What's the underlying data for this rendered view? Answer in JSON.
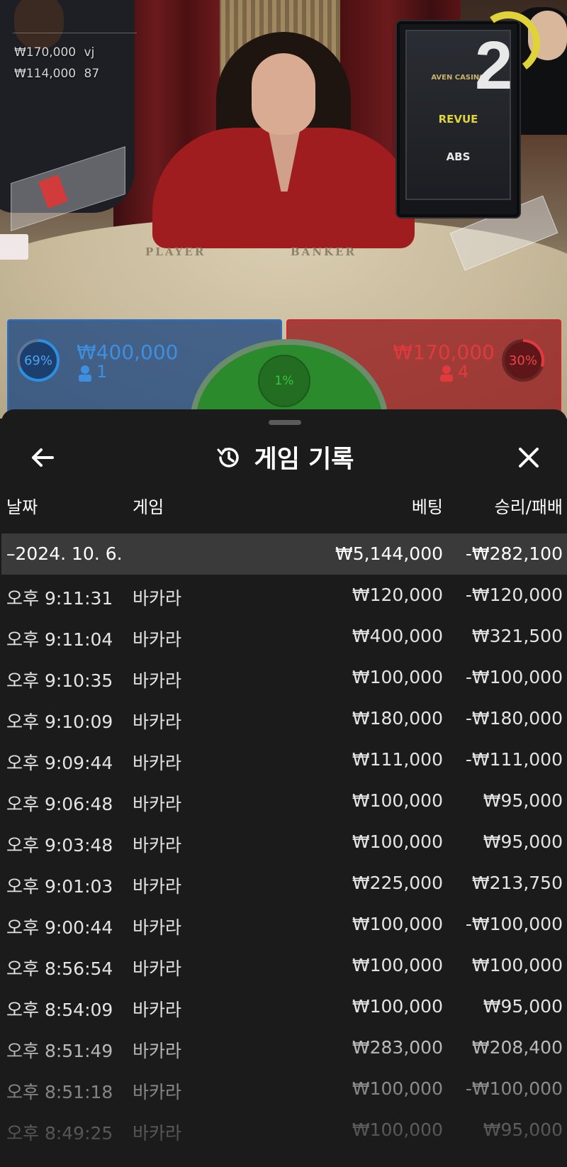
{
  "overlay": {
    "lines": [
      {
        "amount": "₩170,000",
        "user": "vj"
      },
      {
        "amount": "₩114,000",
        "user": "87"
      }
    ]
  },
  "stream": {
    "round_number": "2",
    "table_labels": {
      "player": "PLAYER",
      "banker": "BANKER"
    },
    "monitor_logos": [
      "AVEN CASINO",
      "REVUE",
      "ABS"
    ]
  },
  "bets": {
    "player": {
      "percent": "69%",
      "amount": "₩400,000",
      "players": "1",
      "color": "#2d6fc7"
    },
    "banker": {
      "percent": "30%",
      "amount": "₩170,000",
      "players": "4",
      "color": "#c62a2d"
    },
    "tie": {
      "percent": "1%",
      "color": "#2b8a2b"
    }
  },
  "history": {
    "title": "게임 기록",
    "icons": {
      "back": "back-arrow-icon",
      "history": "history-icon",
      "close": "close-icon"
    },
    "columns": {
      "date": "날짜",
      "game": "게임",
      "bet": "베팅",
      "result": "승리/패배"
    },
    "date_group": {
      "date": "–2024. 10. 6.",
      "bet_total": "₩5,144,000",
      "result_total": "-₩282,100"
    },
    "rows": [
      {
        "time": "오후 9:11:31",
        "game": "바카라",
        "bet": "₩120,000",
        "result": "-₩120,000"
      },
      {
        "time": "오후 9:11:04",
        "game": "바카라",
        "bet": "₩400,000",
        "result": "₩321,500"
      },
      {
        "time": "오후 9:10:35",
        "game": "바카라",
        "bet": "₩100,000",
        "result": "-₩100,000"
      },
      {
        "time": "오후 9:10:09",
        "game": "바카라",
        "bet": "₩180,000",
        "result": "-₩180,000"
      },
      {
        "time": "오후 9:09:44",
        "game": "바카라",
        "bet": "₩111,000",
        "result": "-₩111,000"
      },
      {
        "time": "오후 9:06:48",
        "game": "바카라",
        "bet": "₩100,000",
        "result": "₩95,000"
      },
      {
        "time": "오후 9:03:48",
        "game": "바카라",
        "bet": "₩100,000",
        "result": "₩95,000"
      },
      {
        "time": "오후 9:01:03",
        "game": "바카라",
        "bet": "₩225,000",
        "result": "₩213,750"
      },
      {
        "time": "오후 9:00:44",
        "game": "바카라",
        "bet": "₩100,000",
        "result": "-₩100,000"
      },
      {
        "time": "오후 8:56:54",
        "game": "바카라",
        "bet": "₩100,000",
        "result": "₩100,000"
      },
      {
        "time": "오후 8:54:09",
        "game": "바카라",
        "bet": "₩100,000",
        "result": "₩95,000"
      },
      {
        "time": "오후 8:51:49",
        "game": "바카라",
        "bet": "₩283,000",
        "result": "₩208,400"
      },
      {
        "time": "오후 8:51:18",
        "game": "바카라",
        "bet": "₩100,000",
        "result": "-₩100,000"
      },
      {
        "time": "오후 8:49:25",
        "game": "바카라",
        "bet": "₩100,000",
        "result": "₩95,000"
      }
    ]
  }
}
